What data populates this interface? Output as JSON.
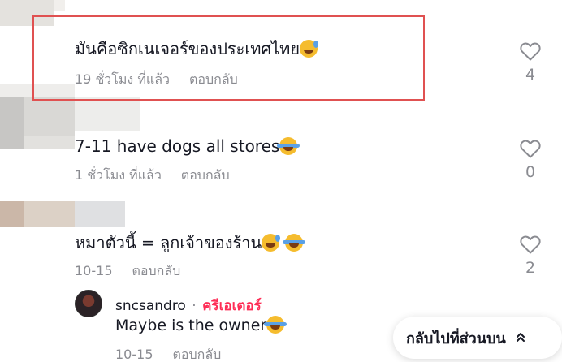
{
  "comments": [
    {
      "text": "มันคือซิกเนเจอร์ของประเทศไทย",
      "emoji": "grin-sweat",
      "time": "19 ชั่วโมง ที่แล้ว",
      "reply_label": "ตอบกลับ",
      "likes": "4"
    },
    {
      "text": "7-11 have dogs all stores",
      "emoji": "rolling-laugh",
      "time": "1 ชั่วโมง ที่แล้ว",
      "reply_label": "ตอบกลับ",
      "likes": "0"
    },
    {
      "text": "หมาตัวนี้ = ลูกเจ้าของร้าน",
      "emoji": "grin-sweat, tears-of-joy",
      "time": "10-15",
      "reply_label": "ตอบกลับ",
      "likes": "2"
    }
  ],
  "reply": {
    "author": "sncsandro",
    "separator": "·",
    "badge": "ครีเอเตอร์",
    "text": "Maybe is the owner",
    "emoji": "tears-of-joy",
    "time": "10-15",
    "reply_label": "ตอบกลับ"
  },
  "back_to_top": {
    "label": "กลับไปที่ส่วนบน",
    "icon": "double-chevron-up-icon"
  },
  "colors": {
    "highlight": "#e05151",
    "creator_badge": "#fe2c55",
    "meta_text": "#8a8b91"
  }
}
